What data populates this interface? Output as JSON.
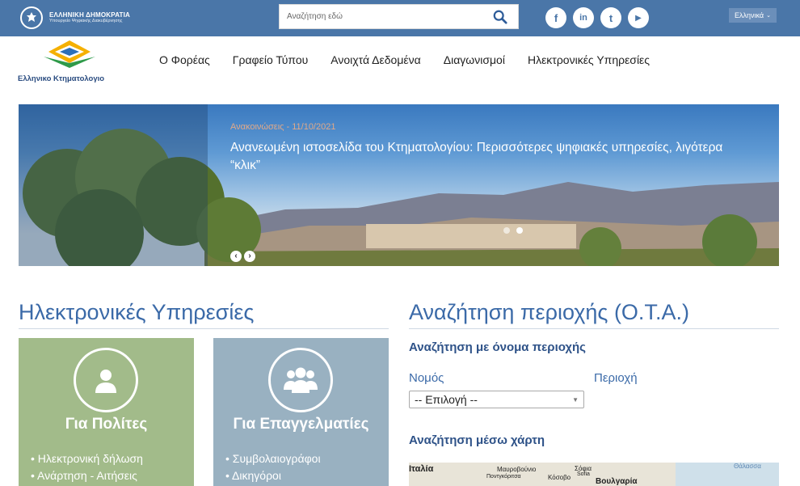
{
  "topbar": {
    "gov_title": "ΕΛΛΗΝΙΚΗ ΔΗΜΟΚΡΑΤΙΑ",
    "gov_subtitle": "Υπουργείο Ψηφιακής Διακυβέρνησης",
    "search_placeholder": "Αναζήτηση εδώ",
    "socials": [
      "facebook-icon",
      "linkedin-icon",
      "twitter-icon",
      "youtube-icon"
    ],
    "social_glyphs": {
      "facebook": "f",
      "linkedin": "in",
      "twitter": "t",
      "youtube": "▶"
    },
    "language": "Ελληνικά"
  },
  "header": {
    "logo_text": "Ελληνικο Κτηματολογιο",
    "nav": [
      "Ο Φορέας",
      "Γραφείο Τύπου",
      "Ανοιχτά Δεδομένα",
      "Διαγωνισμοί",
      "Ηλεκτρονικές Υπηρεσίες"
    ]
  },
  "hero": {
    "meta": "Ανακοινώσεις - 11/10/2021",
    "title": "Ανανεωμένη ιστοσελίδα του Κτηματολογίου: Περισσότερες ψηφιακές υπηρεσίες, λιγότερα “κλικ”",
    "slide_count": 2,
    "active_slide": 2,
    "prev_glyph": "‹",
    "next_glyph": "›"
  },
  "services": {
    "title": "Ηλεκτρονικές Υπηρεσίες",
    "citizens": {
      "title": "Για Πολίτες",
      "items": [
        "Ηλεκτρονική δήλωση",
        "Ανάρτηση - Αιτήσεις"
      ]
    },
    "professionals": {
      "title": "Για Επαγγελματίες",
      "items": [
        "Συμβολαιογράφοι",
        "Δικηγόροι"
      ]
    }
  },
  "area_search": {
    "title": "Αναζήτηση περιοχής (Ο.Τ.Α.)",
    "by_name": "Αναζήτηση με όνομα περιοχής",
    "prefecture_label": "Νομός",
    "region_label": "Περιοχή",
    "select_value": "-- Επιλογή --",
    "by_map": "Αναζήτηση μέσω χάρτη",
    "map_labels": [
      "Ιταλία",
      "Μαυροβούνιο",
      "Ποντγκόριτσα",
      "Κόσοβο",
      "Σόφια",
      "Sofia",
      "Βουλγαρία",
      "Θάλασσα"
    ]
  },
  "colors": {
    "topbar": "#4a76a8",
    "heading": "#3b6aa8",
    "citizens_card": "#a2bb8a",
    "professionals_card": "#99b1c1"
  }
}
